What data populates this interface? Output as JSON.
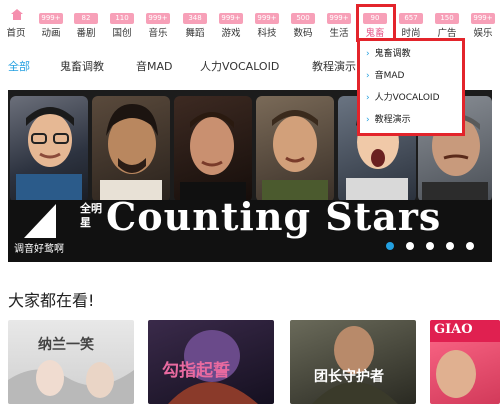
{
  "nav": {
    "items": [
      {
        "label": "首页",
        "badge": ""
      },
      {
        "label": "动画",
        "badge": "999+"
      },
      {
        "label": "番剧",
        "badge": "82"
      },
      {
        "label": "国创",
        "badge": "110"
      },
      {
        "label": "音乐",
        "badge": "999+"
      },
      {
        "label": "舞蹈",
        "badge": "348"
      },
      {
        "label": "游戏",
        "badge": "999+"
      },
      {
        "label": "科技",
        "badge": "999+"
      },
      {
        "label": "数码",
        "badge": "500"
      },
      {
        "label": "生活",
        "badge": "999+"
      },
      {
        "label": "鬼畜",
        "badge": "90"
      },
      {
        "label": "时尚",
        "badge": "657"
      },
      {
        "label": "广告",
        "badge": "150"
      },
      {
        "label": "娱乐",
        "badge": "999+"
      }
    ],
    "active_index": 10
  },
  "subtabs": [
    "全部",
    "鬼畜调教",
    "音MAD",
    "人力VOCALOID",
    "教程演示"
  ],
  "dropdown": [
    "鬼畜调教",
    "音MAD",
    "人力VOCALOID",
    "教程演示"
  ],
  "banner": {
    "title": "Counting Stars",
    "badge_text": "全明星",
    "caption": "调音好鹜啊",
    "slide_count": 5,
    "active_slide": 0
  },
  "section": {
    "title": "大家都在看!",
    "thumbs": [
      {
        "text": "纳兰一笑"
      },
      {
        "text": "勾指起誓"
      },
      {
        "text": "团长守护者"
      },
      {
        "text": "GIAO"
      }
    ]
  },
  "colors": {
    "accent": "#23a0e0",
    "badge": "#f7a0b8",
    "highlight": "#e3242b",
    "active_nav": "#e65a8a"
  }
}
